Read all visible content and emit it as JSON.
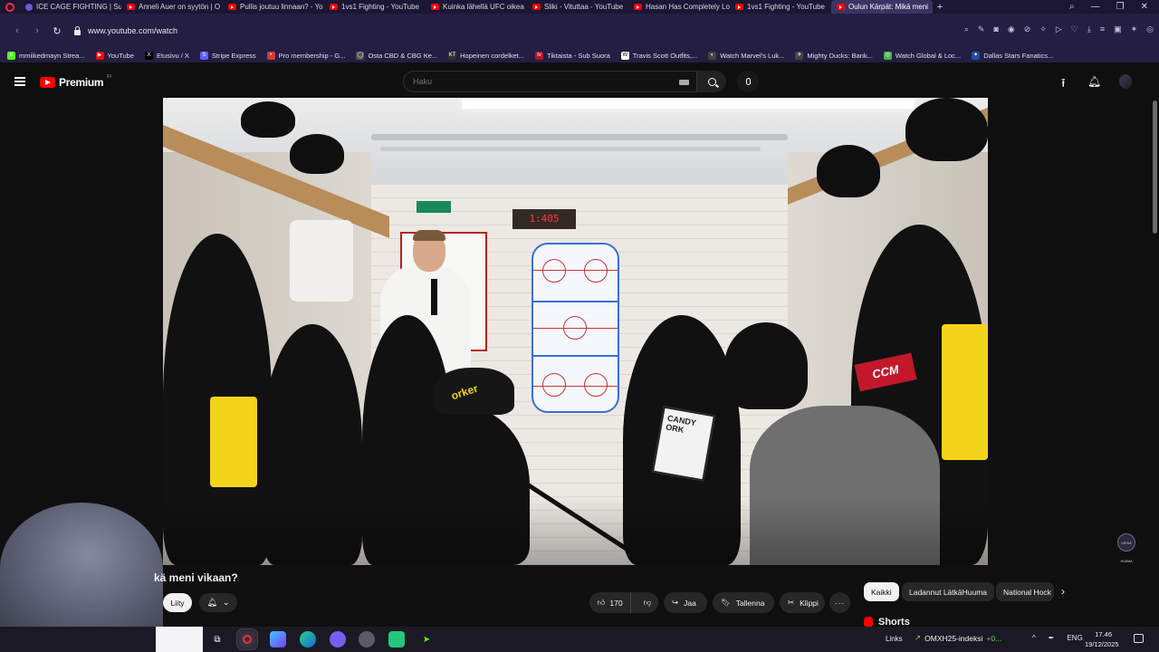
{
  "browser": {
    "tabs": [
      {
        "label": "ICE CAGE FIGHTING | Sur",
        "icon": "twitch-icon"
      },
      {
        "label": "Anneli Auer on syytön | O",
        "icon": "youtube-icon"
      },
      {
        "label": "Pullis joutuu linnaan? - Yo",
        "icon": "youtube-icon"
      },
      {
        "label": "1vs1 Fighting - YouTube",
        "icon": "youtube-icon"
      },
      {
        "label": "Kuinka lähellä UFC oikea",
        "icon": "youtube-icon"
      },
      {
        "label": "Sliki - Vituttaa - YouTube",
        "icon": "youtube-icon"
      },
      {
        "label": "Hasan Has Completely Lo",
        "icon": "youtube-icon"
      },
      {
        "label": "1vs1 Fighting - YouTube",
        "icon": "youtube-icon"
      },
      {
        "label": "Oulun Kärpät: Mikä meni",
        "icon": "youtube-icon",
        "active": true
      }
    ],
    "add_tab": "+",
    "url": "www.youtube.com/watch",
    "bookmarks": [
      {
        "label": "mmiikedmayn Strea...",
        "color": "#53fc18",
        "glyph": "K"
      },
      {
        "label": "YouTube",
        "color": "#ff0000",
        "glyph": "▶"
      },
      {
        "label": "Etusivu / X",
        "color": "#000000",
        "glyph": "X"
      },
      {
        "label": "Stripe Express",
        "color": "#635bff",
        "glyph": "S"
      },
      {
        "label": "Pro membership - G...",
        "color": "#d23b3b",
        "glyph": "•"
      },
      {
        "label": "Osta CBD & CBG Ke...",
        "color": "#555555",
        "glyph": "◯"
      },
      {
        "label": "Hopeinen cordelket...",
        "color": "#333333",
        "glyph": "KT"
      },
      {
        "label": "Tiktaista - Sub Suora",
        "color": "#b5122a",
        "glyph": "tv"
      },
      {
        "label": "Travis Scott Outfits,...",
        "color": "#ffffff",
        "glyph": "W"
      },
      {
        "label": "Watch Marvel's Luk...",
        "color": "#444444",
        "glyph": "◐"
      },
      {
        "label": "Mighty Ducks: Bank...",
        "color": "#444444",
        "glyph": "✈"
      },
      {
        "label": "Watch Global & Loc...",
        "color": "#4caf50",
        "glyph": "◎"
      },
      {
        "label": "Dallas Stars Fanatics...",
        "color": "#1f4fa8",
        "glyph": "✦"
      }
    ]
  },
  "youtube": {
    "logo_text": "Premium",
    "logo_region": "FI",
    "search_placeholder": "Haku",
    "video": {
      "scoreboard": "1:405",
      "cap_text": "orker",
      "bag_text": "CANDY ORK",
      "jersey_brand": "CCM",
      "watermark": "LÄTKÄ HUUMA"
    },
    "title": "kä meni vikaan?",
    "join_label": "Liity",
    "likes": "170",
    "share_label": "Jaa",
    "save_label": "Tallenna",
    "clip_label": "Klippi",
    "more_label": "···",
    "chips": [
      {
        "label": "Kaikki",
        "selected": true
      },
      {
        "label": "Ladannut LätkäHuuma"
      },
      {
        "label": "National Hock"
      }
    ],
    "shorts_label": "Shorts"
  },
  "taskbar": {
    "stock_name": "OMXH25-indeksi",
    "stock_change": "+0...",
    "links_label": "Links",
    "language": "ENG",
    "time": "17.46",
    "date": "19/12/2025"
  },
  "colors": {
    "youtube_red": "#ff0000",
    "browser_tab_bg": "#1a1633",
    "page_bg": "#0f0f0f",
    "stock_up": "#5ed25e"
  }
}
